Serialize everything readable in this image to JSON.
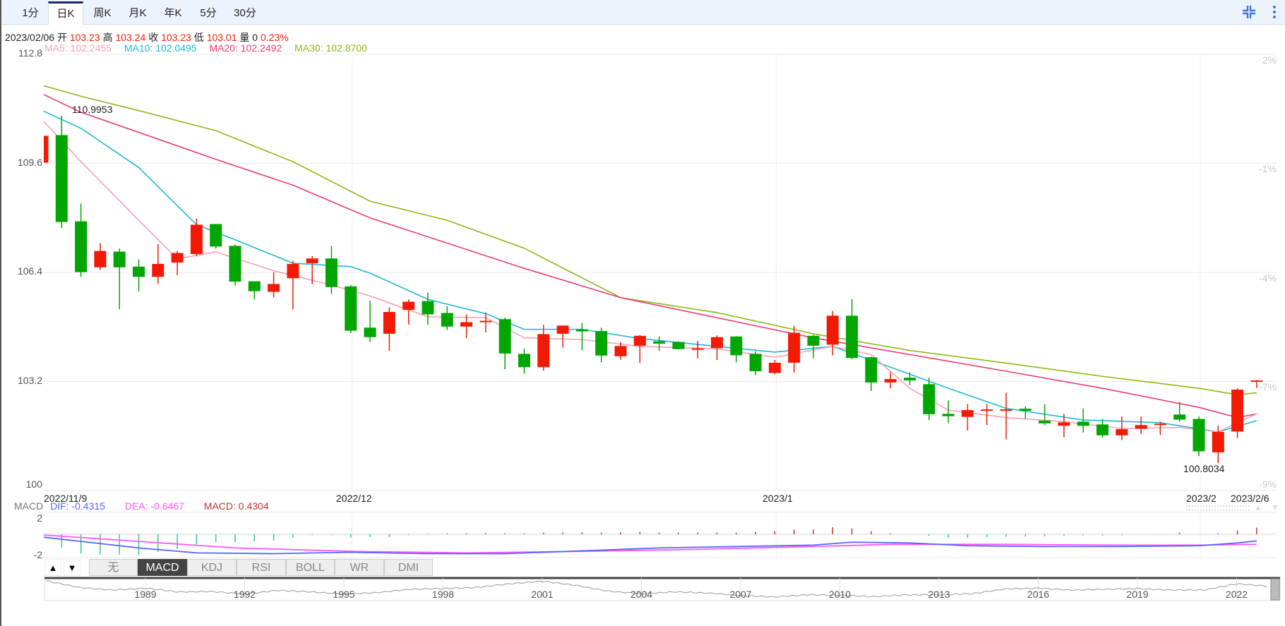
{
  "tabs": [
    {
      "label": "1分",
      "active": false
    },
    {
      "label": "日K",
      "active": true
    },
    {
      "label": "周K",
      "active": false
    },
    {
      "label": "月K",
      "active": false
    },
    {
      "label": "年K",
      "active": false
    },
    {
      "label": "5分",
      "active": false
    },
    {
      "label": "30分",
      "active": false
    }
  ],
  "toolbar": {
    "collapse_icon": "compress-icon",
    "more_icon": "more-vertical-icon"
  },
  "info": {
    "date": "2023/02/06",
    "open_label": "开",
    "open": "103.23",
    "high_label": "高",
    "high": "103.24",
    "close_label": "收",
    "close": "103.23",
    "low_label": "低",
    "low": "103.01",
    "volume_label": "量",
    "volume": "0",
    "change": "0.23%"
  },
  "ma_legend": {
    "ma5": "MA5: 102.2455",
    "ma10": "MA10: 102.0495",
    "ma20": "MA20: 102.2492",
    "ma30": "MA30: 102.8700"
  },
  "colors": {
    "up": "#f21a05",
    "down": "#02a602",
    "ma5": "#f7a1b8",
    "ma10": "#1cb9d6",
    "ma20": "#ec3a74",
    "ma30": "#8db815",
    "dif": "#5566ff",
    "dea": "#ff55ff",
    "macd": "#c33333",
    "macd_up": "#c0392b",
    "macd_down": "#3cc28e"
  },
  "chart_data": {
    "type": "candlestick",
    "ylim": [
      100,
      112.8
    ],
    "yticks": [
      "112.8",
      "109.6",
      "106.4",
      "103.2",
      "100"
    ],
    "pct_ticks": [
      "2%",
      "-1%",
      "-4%",
      "-7%",
      "-9%"
    ],
    "x_labels": [
      {
        "label": "2022/11/9",
        "index": 0
      },
      {
        "label": "2022/12",
        "index": 16
      },
      {
        "label": "2023/1",
        "index": 38
      },
      {
        "label": "2023/2",
        "index": 60
      },
      {
        "label": "2023/2/6",
        "index": 63
      }
    ],
    "ohlc": [
      [
        109.62,
        110.41,
        109.62,
        110.41
      ],
      [
        110.43,
        110.9953,
        107.7,
        107.88
      ],
      [
        107.9,
        108.42,
        106.27,
        106.41
      ],
      [
        106.55,
        107.26,
        106.47,
        107.03
      ],
      [
        107.01,
        107.1,
        105.32,
        106.55
      ],
      [
        106.57,
        106.78,
        105.84,
        106.27
      ],
      [
        106.27,
        107.23,
        106.07,
        106.65
      ],
      [
        106.69,
        107.03,
        106.32,
        106.97
      ],
      [
        106.94,
        107.98,
        106.87,
        107.8
      ],
      [
        107.82,
        107.82,
        107.1,
        107.16
      ],
      [
        107.18,
        107.22,
        106.02,
        106.13
      ],
      [
        106.14,
        106.14,
        105.61,
        105.85
      ],
      [
        105.83,
        106.41,
        105.67,
        106.06
      ],
      [
        106.23,
        106.74,
        105.31,
        106.65
      ],
      [
        106.67,
        106.88,
        106.05,
        106.81
      ],
      [
        106.81,
        107.18,
        105.77,
        105.97
      ],
      [
        105.99,
        106.03,
        104.62,
        104.69
      ],
      [
        104.78,
        105.57,
        104.36,
        104.5
      ],
      [
        104.6,
        105.38,
        104.1,
        105.24
      ],
      [
        105.3,
        105.61,
        104.87,
        105.54
      ],
      [
        105.56,
        105.81,
        104.86,
        105.17
      ],
      [
        105.21,
        105.41,
        104.71,
        104.81
      ],
      [
        104.81,
        105.17,
        104.47,
        104.94
      ],
      [
        104.94,
        105.23,
        104.64,
        104.98
      ],
      [
        105.03,
        105.08,
        103.56,
        104.02
      ],
      [
        104.01,
        104.16,
        103.43,
        103.62
      ],
      [
        103.62,
        104.86,
        103.52,
        104.59
      ],
      [
        104.6,
        104.84,
        104.19,
        104.84
      ],
      [
        104.73,
        104.92,
        104.12,
        104.67
      ],
      [
        104.68,
        104.78,
        103.76,
        103.96
      ],
      [
        103.94,
        104.36,
        103.84,
        104.24
      ],
      [
        104.25,
        104.56,
        103.74,
        104.54
      ],
      [
        104.38,
        104.52,
        104.1,
        104.31
      ],
      [
        104.36,
        104.38,
        104.14,
        104.15
      ],
      [
        104.15,
        104.39,
        103.88,
        104.17
      ],
      [
        104.18,
        104.55,
        103.83,
        104.5
      ],
      [
        104.52,
        104.53,
        103.76,
        103.97
      ],
      [
        104.01,
        104.09,
        103.38,
        103.5
      ],
      [
        103.45,
        103.83,
        103.41,
        103.75
      ],
      [
        103.75,
        104.83,
        103.46,
        104.63
      ],
      [
        104.54,
        104.57,
        103.88,
        104.25
      ],
      [
        104.28,
        105.27,
        103.97,
        105.13
      ],
      [
        105.13,
        105.62,
        103.85,
        103.89
      ],
      [
        103.91,
        103.93,
        102.92,
        103.17
      ],
      [
        103.17,
        103.47,
        103.0,
        103.27
      ],
      [
        103.31,
        103.47,
        103.09,
        103.23
      ],
      [
        103.12,
        103.31,
        102.07,
        102.24
      ],
      [
        102.25,
        102.64,
        101.98,
        102.18
      ],
      [
        102.16,
        102.54,
        101.76,
        102.36
      ],
      [
        102.37,
        102.54,
        101.92,
        102.38
      ],
      [
        102.37,
        102.87,
        101.5,
        102.38
      ],
      [
        102.4,
        102.47,
        102.1,
        102.34
      ],
      [
        102.05,
        102.53,
        101.92,
        101.97
      ],
      [
        101.9,
        102.25,
        101.56,
        102.0
      ],
      [
        102.02,
        102.41,
        101.7,
        101.9
      ],
      [
        101.94,
        102.1,
        101.55,
        101.62
      ],
      [
        101.62,
        102.17,
        101.48,
        101.8
      ],
      [
        101.81,
        102.17,
        101.65,
        101.92
      ],
      [
        101.92,
        102.02,
        101.63,
        101.96
      ],
      [
        102.23,
        102.6,
        102.02,
        102.08
      ],
      [
        102.1,
        102.17,
        101.01,
        101.15
      ],
      [
        101.12,
        101.9,
        100.8034,
        101.72
      ],
      [
        101.73,
        103.0,
        101.54,
        102.96
      ],
      [
        103.23,
        103.24,
        103.01,
        103.23
      ]
    ],
    "ma": {
      "ma5": [
        [
          0,
          110.88
        ],
        [
          2,
          109.65
        ],
        [
          5,
          107.93
        ],
        [
          7,
          106.8
        ],
        [
          9,
          107.0
        ],
        [
          12,
          106.45
        ],
        [
          15,
          106.03
        ],
        [
          17,
          105.71
        ],
        [
          20,
          105.1
        ],
        [
          23,
          105.07
        ],
        [
          25,
          104.48
        ],
        [
          28,
          104.43
        ],
        [
          31,
          104.23
        ],
        [
          35,
          104.16
        ],
        [
          38,
          103.91
        ],
        [
          41,
          104.23
        ],
        [
          43,
          103.99
        ],
        [
          45,
          103.0
        ],
        [
          47,
          102.36
        ],
        [
          50,
          102.14
        ],
        [
          53,
          102.02
        ],
        [
          56,
          101.82
        ],
        [
          59,
          101.85
        ],
        [
          61,
          101.72
        ],
        [
          63,
          102.25
        ]
      ],
      "ma10": [
        [
          0,
          111.15
        ],
        [
          2,
          110.63
        ],
        [
          5,
          109.48
        ],
        [
          8,
          107.8
        ],
        [
          10,
          107.36
        ],
        [
          13,
          106.67
        ],
        [
          16,
          106.57
        ],
        [
          17,
          106.38
        ],
        [
          20,
          105.61
        ],
        [
          23,
          105.19
        ],
        [
          25,
          104.73
        ],
        [
          28,
          104.73
        ],
        [
          31,
          104.46
        ],
        [
          35,
          104.23
        ],
        [
          38,
          104.06
        ],
        [
          41,
          104.23
        ],
        [
          44,
          103.62
        ],
        [
          47,
          103.0
        ],
        [
          50,
          102.41
        ],
        [
          54,
          102.07
        ],
        [
          58,
          101.99
        ],
        [
          61,
          101.72
        ],
        [
          63,
          102.05
        ]
      ],
      "ma20": [
        [
          0,
          111.64
        ],
        [
          2,
          111.1
        ],
        [
          5,
          110.51
        ],
        [
          9,
          109.72
        ],
        [
          13,
          108.96
        ],
        [
          17,
          108.0
        ],
        [
          21,
          107.26
        ],
        [
          25,
          106.52
        ],
        [
          30,
          105.66
        ],
        [
          35,
          105.07
        ],
        [
          40,
          104.48
        ],
        [
          45,
          103.99
        ],
        [
          50,
          103.5
        ],
        [
          55,
          103.0
        ],
        [
          60,
          102.44
        ],
        [
          62,
          102.14
        ],
        [
          63,
          102.25
        ]
      ],
      "ma30": [
        [
          0,
          111.89
        ],
        [
          2,
          111.57
        ],
        [
          5,
          111.15
        ],
        [
          9,
          110.56
        ],
        [
          13,
          109.65
        ],
        [
          17,
          108.49
        ],
        [
          21,
          107.93
        ],
        [
          25,
          107.11
        ],
        [
          30,
          105.66
        ],
        [
          35,
          105.22
        ],
        [
          40,
          104.6
        ],
        [
          45,
          104.11
        ],
        [
          50,
          103.74
        ],
        [
          55,
          103.35
        ],
        [
          60,
          103.0
        ],
        [
          62,
          102.81
        ],
        [
          63,
          102.87
        ]
      ]
    },
    "annotations": [
      {
        "label": "110.9953",
        "index": 1,
        "type": "max"
      },
      {
        "label": "100.8034",
        "index": 61,
        "type": "min"
      }
    ]
  },
  "macd": {
    "legend": {
      "title": "MACD",
      "dif": "DIF: -0.4315",
      "dea": "DEA: -0.6467",
      "macd": "MACD: 0.4304"
    },
    "yticks": [
      "2",
      "-2"
    ],
    "hist": [
      -0.9,
      -0.85,
      -1.25,
      -1.3,
      -1.3,
      -1.35,
      -1.15,
      -0.95,
      -0.65,
      -0.5,
      -0.5,
      -0.45,
      -0.4,
      -0.22,
      -0.04,
      -0.04,
      -0.22,
      -0.18,
      -0.18,
      -0.04,
      0.02,
      0.05,
      0.05,
      0.08,
      0.06,
      0.05,
      0.1,
      0.12,
      0.12,
      0.1,
      0.12,
      0.15,
      0.1,
      0.1,
      0.1,
      0.12,
      0.1,
      0.15,
      0.2,
      0.3,
      0.3,
      0.45,
      0.38,
      0.2,
      0.05,
      0.0,
      -0.1,
      -0.22,
      -0.22,
      -0.2,
      -0.16,
      -0.14,
      -0.14,
      -0.1,
      -0.08,
      -0.08,
      -0.06,
      0.0,
      0.01,
      0.1,
      0.0,
      0.06,
      0.25,
      0.43
    ],
    "dif": [
      [
        0,
        -0.19
      ],
      [
        5,
        -0.88
      ],
      [
        8,
        -1.2
      ],
      [
        12,
        -1.25
      ],
      [
        16,
        -1.16
      ],
      [
        20,
        -1.25
      ],
      [
        24,
        -1.25
      ],
      [
        28,
        -1.07
      ],
      [
        32,
        -0.88
      ],
      [
        36,
        -0.79
      ],
      [
        40,
        -0.7
      ],
      [
        42,
        -0.51
      ],
      [
        45,
        -0.56
      ],
      [
        48,
        -0.74
      ],
      [
        52,
        -0.79
      ],
      [
        56,
        -0.79
      ],
      [
        60,
        -0.74
      ],
      [
        62,
        -0.56
      ],
      [
        63,
        -0.4315
      ]
    ],
    "dea": [
      [
        0,
        -0.05
      ],
      [
        5,
        -0.46
      ],
      [
        10,
        -0.88
      ],
      [
        16,
        -1.1
      ],
      [
        22,
        -1.2
      ],
      [
        28,
        -1.1
      ],
      [
        34,
        -0.97
      ],
      [
        40,
        -0.79
      ],
      [
        44,
        -0.65
      ],
      [
        50,
        -0.65
      ],
      [
        56,
        -0.7
      ],
      [
        60,
        -0.7
      ],
      [
        63,
        -0.6467
      ]
    ]
  },
  "indicator_tabs": [
    {
      "label": "无",
      "active": false
    },
    {
      "label": "MACD",
      "active": true
    },
    {
      "label": "KDJ",
      "active": false
    },
    {
      "label": "RSI",
      "active": false
    },
    {
      "label": "BOLL",
      "active": false
    },
    {
      "label": "WR",
      "active": false
    },
    {
      "label": "DMI",
      "active": false
    }
  ],
  "indicator_arrows": {
    "up": "▲",
    "down": "▼"
  },
  "navigator": {
    "years": [
      "1989",
      "1992",
      "1995",
      "1998",
      "2001",
      "2004",
      "2007",
      "2010",
      "2013",
      "2016",
      "2019",
      "2022"
    ],
    "history": [
      [
        1986,
        118
      ],
      [
        1987,
        100
      ],
      [
        1988,
        93
      ],
      [
        1989,
        98
      ],
      [
        1990,
        88
      ],
      [
        1991,
        89
      ],
      [
        1992,
        82
      ],
      [
        1993,
        92
      ],
      [
        1994,
        88
      ],
      [
        1995,
        82
      ],
      [
        1996,
        86
      ],
      [
        1997,
        95
      ],
      [
        1998,
        97
      ],
      [
        1999,
        100
      ],
      [
        2000,
        110
      ],
      [
        2001,
        117
      ],
      [
        2002,
        106
      ],
      [
        2003,
        90
      ],
      [
        2004,
        83
      ],
      [
        2005,
        88
      ],
      [
        2006,
        85
      ],
      [
        2007,
        78
      ],
      [
        2008,
        74
      ],
      [
        2009,
        80
      ],
      [
        2010,
        79
      ],
      [
        2011,
        75
      ],
      [
        2012,
        80
      ],
      [
        2013,
        80
      ],
      [
        2014,
        83
      ],
      [
        2015,
        96
      ],
      [
        2016,
        98
      ],
      [
        2017,
        93
      ],
      [
        2018,
        95
      ],
      [
        2019,
        97
      ],
      [
        2020,
        93
      ],
      [
        2021,
        93
      ],
      [
        2022,
        110
      ],
      [
        2023,
        103
      ]
    ]
  }
}
